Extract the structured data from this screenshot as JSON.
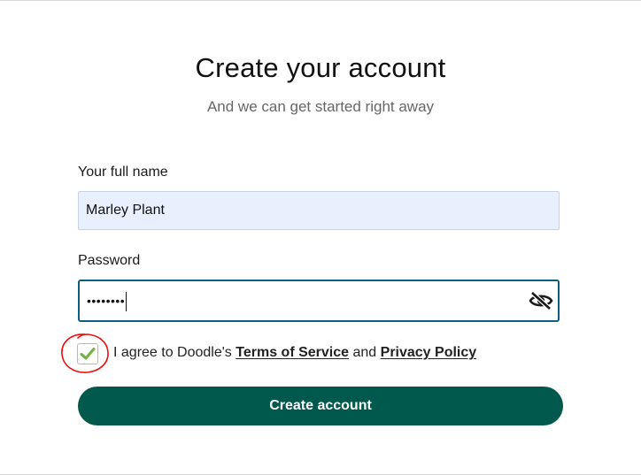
{
  "header": {
    "title": "Create your account",
    "subtitle": "And we can get started right away"
  },
  "form": {
    "name_label": "Your full name",
    "name_value": "Marley Plant",
    "password_label": "Password",
    "password_value": "••••••••",
    "password_toggle_icon": "eye-slash-icon",
    "agree_checked": true,
    "agree_prefix": "I agree to Doodle's",
    "terms_link": "Terms of Service",
    "agree_and": "and",
    "privacy_link": "Privacy Policy",
    "submit_label": "Create account"
  },
  "colors": {
    "primary_button": "#00594c",
    "input_focus_border": "#0b5d86",
    "autofill_background": "#e8f0fe",
    "checkmark": "#6cb33f",
    "annotation_circle": "#e8110f"
  }
}
